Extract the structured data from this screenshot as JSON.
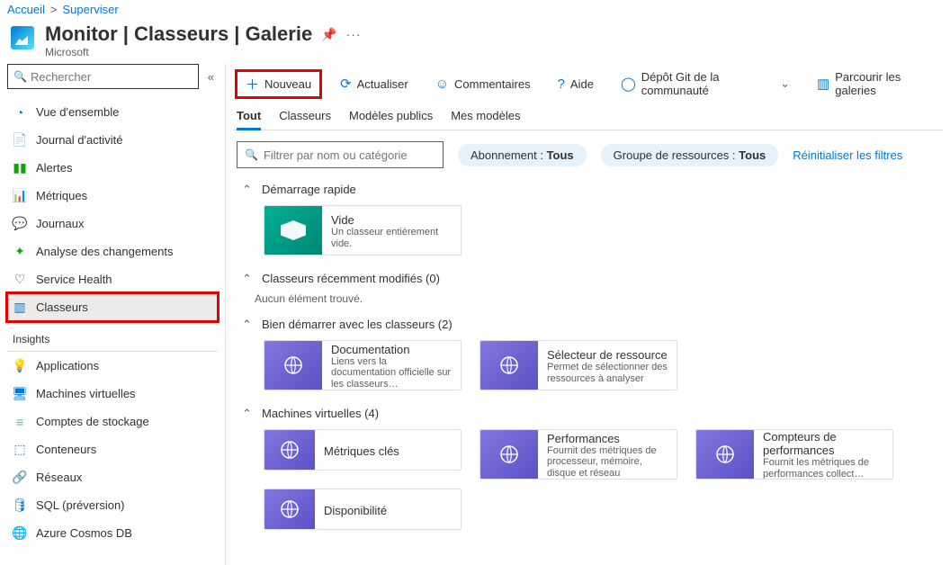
{
  "breadcrumb": {
    "home": "Accueil",
    "sep": ">",
    "sup": "Superviser"
  },
  "header": {
    "title": "Monitor | Classeurs | Galerie",
    "subtitle": "Microsoft"
  },
  "sidebar": {
    "search_placeholder": "Rechercher",
    "items": [
      "Vue d'ensemble",
      "Journal d'activité",
      "Alertes",
      "Métriques",
      "Journaux",
      "Analyse des changements",
      "Service Health",
      "Classeurs"
    ],
    "insights_label": "Insights",
    "insights_items": [
      "Applications",
      "Machines virtuelles",
      "Comptes de stockage",
      "Conteneurs",
      "Réseaux",
      "SQL (préversion)",
      "Azure Cosmos DB"
    ]
  },
  "toolbar": {
    "new": "Nouveau",
    "refresh": "Actualiser",
    "comments": "Commentaires",
    "help": "Aide",
    "github": "Dépôt Git de la communauté",
    "browse": "Parcourir les galeries"
  },
  "tabs": {
    "all": "Tout",
    "workbooks": "Classeurs",
    "public": "Modèles publics",
    "mine": "Mes modèles"
  },
  "filters": {
    "placeholder": "Filtrer par nom ou catégorie",
    "sub_label": "Abonnement :",
    "sub_val": "Tous",
    "rg_label": "Groupe de ressources :",
    "rg_val": "Tous",
    "reset": "Réinitialiser les filtres"
  },
  "sections": {
    "quick": {
      "title": "Démarrage rapide",
      "card_empty": {
        "name": "Vide",
        "desc": "Un classeur entièrement vide."
      }
    },
    "recent": {
      "title": "Classeurs récemment modifiés (0)",
      "empty": "Aucun élément trouvé."
    },
    "getstarted": {
      "title": "Bien démarrer avec les classeurs (2)",
      "cards": [
        {
          "name": "Documentation",
          "desc": "Liens vers la documentation officielle sur les classeurs…"
        },
        {
          "name": "Sélecteur de ressource",
          "desc": "Permet de sélectionner des ressources à analyser"
        }
      ]
    },
    "vm": {
      "title": "Machines virtuelles (4)",
      "cards": [
        {
          "name": "Métriques clés",
          "desc": ""
        },
        {
          "name": "Performances",
          "desc": "Fournit des métriques de processeur, mémoire, disque et réseau"
        },
        {
          "name": "Compteurs de performances",
          "desc": "Fournit les métriques de performances collect…"
        },
        {
          "name": "Disponibilité",
          "desc": ""
        }
      ]
    }
  }
}
